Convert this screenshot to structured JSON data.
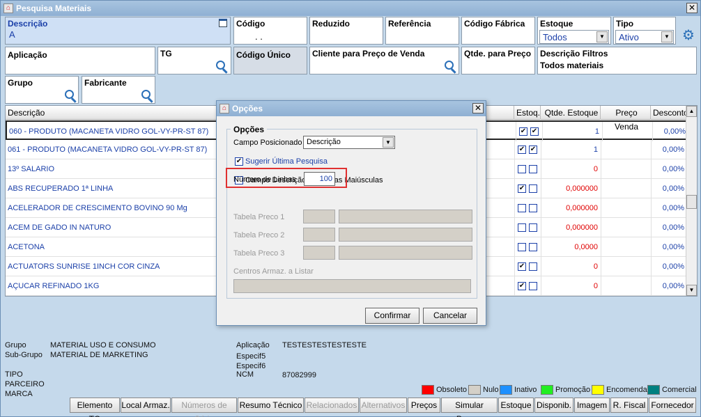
{
  "window": {
    "title": "Pesquisa Materiais",
    "close": "✕"
  },
  "filters": {
    "descricao": {
      "label": "Descrição",
      "value": "A"
    },
    "codigo": {
      "label": "Código",
      "value": ". ."
    },
    "reduzido": {
      "label": "Reduzido"
    },
    "referencia": {
      "label": "Referência"
    },
    "codigo_fabrica": {
      "label": "Código Fábrica"
    },
    "estoque": {
      "label": "Estoque",
      "value": "Todos"
    },
    "tipo": {
      "label": "Tipo",
      "value": "Ativo"
    },
    "aplicacao": {
      "label": "Aplicação"
    },
    "tg": {
      "label": "TG"
    },
    "codigo_unico": {
      "label": "Código Único"
    },
    "cliente_preco": {
      "label": "Cliente para Preço de Venda"
    },
    "qtde_preco": {
      "label": "Qtde. para Preço"
    },
    "descricao_filtros": {
      "label": "Descrição Filtros",
      "value": "Todos materiais"
    },
    "grupo": {
      "label": "Grupo"
    },
    "fabricante": {
      "label": "Fabricante"
    }
  },
  "grid": {
    "headers": [
      "Descrição",
      "Estoq.",
      "Qtde. Estoque",
      "Preço Venda",
      "Desconto."
    ],
    "rows": [
      {
        "desc": "060 - PRODUTO (MACANETA VIDRO GOL-VY-PR-ST 87)",
        "cb1": "✔",
        "cb2": "✔",
        "qtde": "1",
        "desconto": "0,00%",
        "red": false
      },
      {
        "desc": "061 - PRODUTO (MACANETA VIDRO GOL-VY-PR-ST 87)",
        "cb1": "✔",
        "cb2": "✔",
        "qtde": "1",
        "desconto": "0,00%",
        "red": false
      },
      {
        "desc": "13º SALARIO",
        "cb1": "",
        "cb2": "",
        "qtde": "0",
        "desconto": "0,00%",
        "red": true
      },
      {
        "desc": "ABS RECUPERADO 1ª LINHA",
        "cb1": "✔",
        "cb2": "",
        "qtde": "0,000000",
        "desconto": "0,00%",
        "red": true
      },
      {
        "desc": "ACELERADOR DE CRESCIMENTO BOVINO 90 Mg",
        "cb1": "",
        "cb2": "",
        "qtde": "0,000000",
        "desconto": "0,00%",
        "red": true
      },
      {
        "desc": "ACEM  DE GADO IN NATURO",
        "cb1": "",
        "cb2": "",
        "qtde": "0,000000",
        "desconto": "0,00%",
        "red": true
      },
      {
        "desc": "ACETONA",
        "cb1": "",
        "cb2": "",
        "qtde": "0,0000",
        "desconto": "0,00%",
        "red": true
      },
      {
        "desc": "ACTUATORS SUNRISE 1INCH COR CINZA",
        "cb1": "✔",
        "cb2": "",
        "qtde": "0",
        "desconto": "0,00%",
        "red": true
      },
      {
        "desc": "AÇUCAR REFINADO 1KG",
        "cb1": "✔",
        "cb2": "",
        "qtde": "0",
        "desconto": "0,00%",
        "red": true
      }
    ]
  },
  "info": {
    "grupo_label": "Grupo",
    "grupo_value": "MATERIAL USO E CONSUMO",
    "subgrupo_label": "Sub-Grupo",
    "subgrupo_value": "MATERIAL DE MARKETING",
    "tipo_label": "TIPO",
    "parceiro_label": "PARCEIRO",
    "marca_label": "MARCA",
    "aplicacao_label": "Aplicação",
    "aplicacao_value": "TESTESTESTESTESTE",
    "especif5_label": "Especif5",
    "especif6_label": "Especif6",
    "ncm_label": "NCM",
    "ncm_value": "87082999"
  },
  "legend": [
    {
      "label": "Obsoleto",
      "color": "#ff0000"
    },
    {
      "label": "Nulo",
      "color": "#d4d0c8"
    },
    {
      "label": "Inativo",
      "color": "#1e90ff"
    },
    {
      "label": "Promoção",
      "color": "#22ee22"
    },
    {
      "label": "Encomenda",
      "color": "#ffff00"
    },
    {
      "label": "Comercial",
      "color": "#008080"
    }
  ],
  "buttons": [
    {
      "label": "Elemento TG",
      "disabled": false
    },
    {
      "label": "Local Armaz.",
      "disabled": false
    },
    {
      "label": "Números de Série",
      "disabled": true
    },
    {
      "label": "Resumo Técnico",
      "disabled": false
    },
    {
      "label": "Relacionados",
      "disabled": true
    },
    {
      "label": "Alternativos",
      "disabled": true
    },
    {
      "label": "Preços",
      "disabled": false
    },
    {
      "label": "Simular Prazos",
      "disabled": false
    },
    {
      "label": "Estoque",
      "disabled": false
    },
    {
      "label": "Disponib.",
      "disabled": false
    },
    {
      "label": "Imagem",
      "disabled": false
    },
    {
      "label": "R. Fiscal",
      "disabled": false
    },
    {
      "label": "Fornecedor",
      "disabled": false
    }
  ],
  "dialog": {
    "title": "Opções",
    "close": "✕",
    "group": "Opções",
    "campo_posicionado_label": "Campo Posicionado",
    "campo_posicionado_value": "Descrição",
    "sugerir_label": "Sugerir Última Pesquisa",
    "maiusculas_label": "Campo Descrição em Letras Maiúsculas",
    "numero_linhas_label": "Número de Linhas",
    "numero_linhas_value": "100",
    "tabela1": "Tabela Preco 1",
    "tabela2": "Tabela Preco 2",
    "tabela3": "Tabela Preco 3",
    "centros_label": "Centros Armaz. a Listar",
    "confirmar": "Confirmar",
    "cancelar": "Cancelar",
    "highlight_color": "#e03030"
  }
}
